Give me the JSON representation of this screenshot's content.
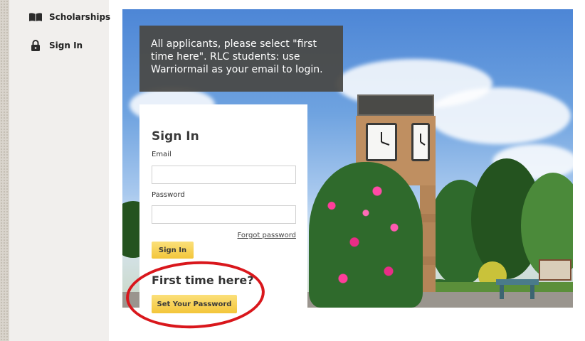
{
  "sidebar": {
    "items": [
      {
        "label": "Scholarships",
        "icon": "open-book-icon"
      },
      {
        "label": "Sign In",
        "icon": "padlock-icon"
      }
    ]
  },
  "banner": {
    "text": "All applicants, please select \"first time here\". RLC students: use Warriormail as your email to login."
  },
  "signin": {
    "title": "Sign In",
    "email_label": "Email",
    "email_value": "",
    "password_label": "Password",
    "password_value": "",
    "forgot_label": "Forgot password",
    "button_label": "Sign In"
  },
  "first_time": {
    "heading": "First time here?",
    "button_label": "Set Your Password"
  },
  "colors": {
    "accent_yellow": "#f3c63a",
    "annotation_red": "#d9171c",
    "banner_bg": "#4a4a48",
    "sidebar_bg": "#f1efed"
  }
}
